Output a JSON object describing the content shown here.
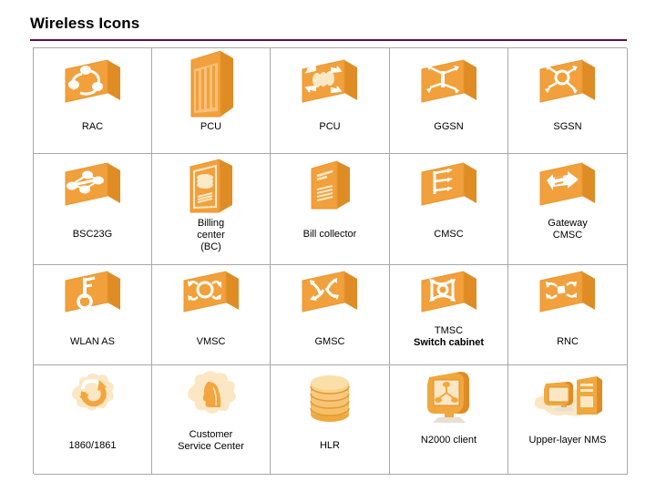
{
  "header": {
    "title": "Wireless Icons",
    "rule_color": "#5b1236"
  },
  "palette": {
    "icon_orange_front": "#f2a03c",
    "icon_orange_top": "#f7c078",
    "icon_orange_side": "#e08c25",
    "icon_cream": "#fce9c8",
    "icon_white": "#ffffff",
    "grid_line": "#a8a8a8",
    "text": "#000000"
  },
  "grid": {
    "columns": 5,
    "rows": 4,
    "cells": [
      {
        "label": "RAC",
        "sublabel": "",
        "icon": "rac-box-icon"
      },
      {
        "label": "PCU",
        "sublabel": "",
        "icon": "pcu-tower-icon"
      },
      {
        "label": "PCU",
        "sublabel": "",
        "icon": "pcu-box-icon"
      },
      {
        "label": "GGSN",
        "sublabel": "",
        "icon": "ggsn-box-icon"
      },
      {
        "label": "SGSN",
        "sublabel": "",
        "icon": "sgsn-box-icon"
      },
      {
        "label": "BSC23G",
        "sublabel": "",
        "icon": "bsc23g-box-icon"
      },
      {
        "label": "Billing",
        "sublabel": "center\n(BC)",
        "icon": "billing-center-icon"
      },
      {
        "label": "Bill collector",
        "sublabel": "",
        "icon": "bill-collector-icon"
      },
      {
        "label": "CMSC",
        "sublabel": "",
        "icon": "cmsc-box-icon"
      },
      {
        "label": "Gateway",
        "sublabel": "CMSC",
        "icon": "gateway-cmsc-box-icon"
      },
      {
        "label": "WLAN AS",
        "sublabel": "",
        "icon": "wlan-as-box-icon"
      },
      {
        "label": "VMSC",
        "sublabel": "",
        "icon": "vmsc-box-icon"
      },
      {
        "label": "GMSC",
        "sublabel": "",
        "icon": "gmsc-box-icon"
      },
      {
        "label": "TMSC",
        "sublabel": "Switch cabinet",
        "icon": "tmsc-box-icon"
      },
      {
        "label": "RNC",
        "sublabel": "",
        "icon": "rnc-box-icon"
      },
      {
        "label": "1860/1861",
        "sublabel": "",
        "icon": "cloud-refresh-icon"
      },
      {
        "label": "Customer",
        "sublabel": "Service Center",
        "icon": "customer-service-center-icon"
      },
      {
        "label": "HLR",
        "sublabel": "",
        "icon": "hlr-database-icon"
      },
      {
        "label": "N2000 client",
        "sublabel": "",
        "icon": "n2000-client-monitor-icon"
      },
      {
        "label": "Upper-layer NMS",
        "sublabel": "",
        "icon": "upper-layer-nms-icon"
      }
    ]
  }
}
